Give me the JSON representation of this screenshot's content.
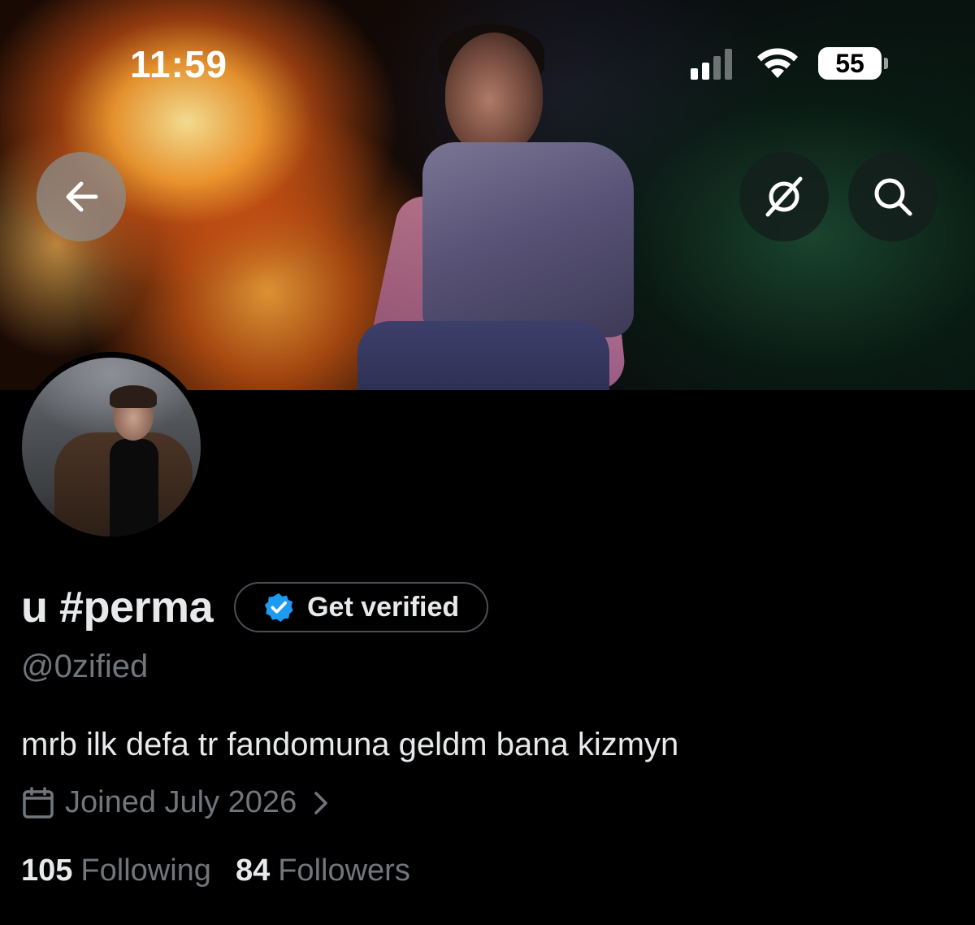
{
  "status_bar": {
    "time": "11:59",
    "battery_level": "55",
    "signal_bars_active": 2,
    "signal_bars_total": 4
  },
  "header": {
    "back_icon": "arrow-left-icon",
    "grok_icon": "grok-icon",
    "search_icon": "search-icon"
  },
  "profile": {
    "display_name": "u #perma",
    "get_verified_label": "Get verified",
    "verified_badge_color": "#1d9bf0",
    "handle": "@0zified",
    "bio": "mrb ilk defa tr fandomuna geldm bana kizmyn",
    "joined": "Joined July 2026",
    "following_count": "105",
    "following_label": "Following",
    "followers_count": "84",
    "followers_label": "Followers"
  },
  "colors": {
    "background": "#000000",
    "primary_text": "#e7e9ea",
    "secondary_text": "#71767b",
    "accent": "#1d9bf0"
  }
}
